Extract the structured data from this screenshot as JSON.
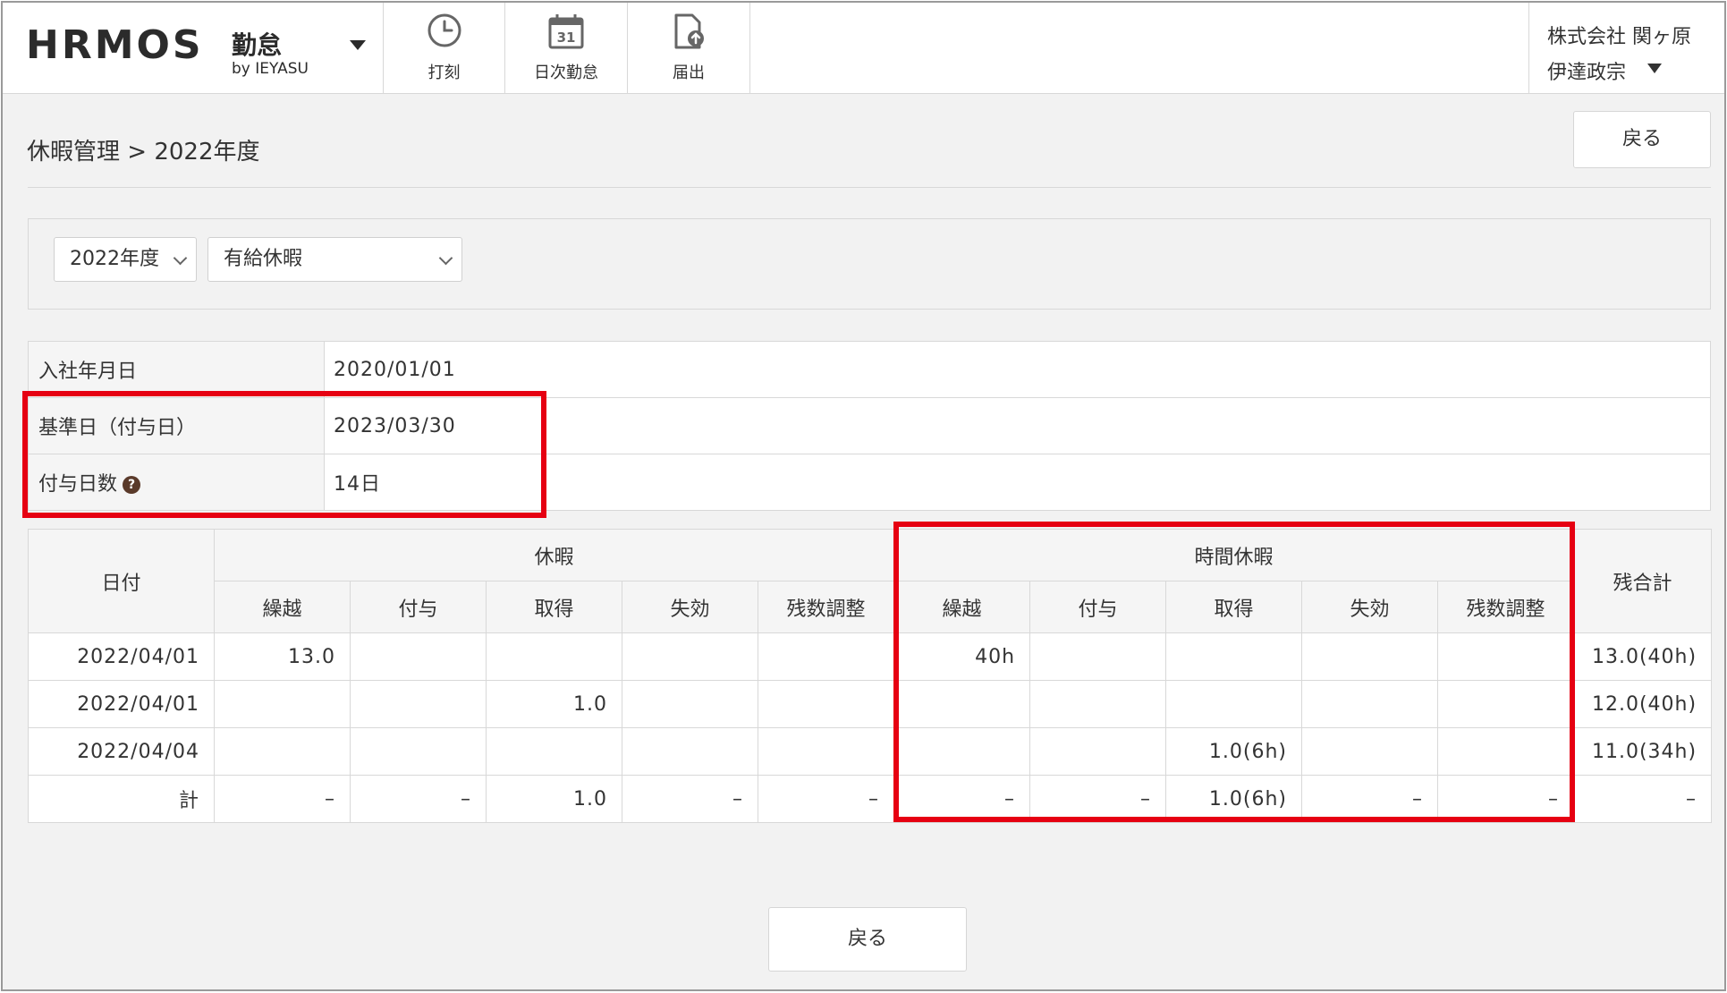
{
  "header": {
    "logo_text": "HRMOS",
    "logo_product": "勤怠",
    "logo_by": "by IEYASU",
    "nav": [
      {
        "label": "打刻",
        "icon": "clock-icon"
      },
      {
        "label": "日次勤怠",
        "icon": "calendar-icon"
      },
      {
        "label": "届出",
        "icon": "document-upload-icon"
      }
    ],
    "company": "株式会社 関ヶ原",
    "user": "伊達政宗"
  },
  "breadcrumb": "休暇管理 > 2022年度",
  "back_label": "戻る",
  "filter": {
    "year": "2022年度",
    "type": "有給休暇"
  },
  "info": [
    {
      "label": "入社年月日",
      "value": "2020/01/01"
    },
    {
      "label": "基準日（付与日）",
      "value": "2023/03/30"
    },
    {
      "label": "付与日数",
      "value": "14日"
    }
  ],
  "table": {
    "col_date": "日付",
    "group_leave": "休暇",
    "group_hourly": "時間休暇",
    "col_remaining": "残合計",
    "sub_cols": [
      "繰越",
      "付与",
      "取得",
      "失効",
      "残数調整"
    ],
    "rows": [
      {
        "date": "2022/04/01",
        "cells": [
          "13.0",
          "",
          "",
          "",
          "",
          "40h",
          "",
          "",
          "",
          ""
        ],
        "remaining": "13.0(40h)"
      },
      {
        "date": "2022/04/01",
        "cells": [
          "",
          "",
          "1.0",
          "",
          "",
          "",
          "",
          "",
          "",
          ""
        ],
        "remaining": "12.0(40h)"
      },
      {
        "date": "2022/04/04",
        "cells": [
          "",
          "",
          "",
          "",
          "",
          "",
          "",
          "1.0(6h)",
          "",
          ""
        ],
        "remaining": "11.0(34h)"
      },
      {
        "date": "計",
        "cells": [
          "–",
          "–",
          "1.0",
          "–",
          "–",
          "–",
          "–",
          "1.0(6h)",
          "–",
          "–"
        ],
        "remaining": "–"
      }
    ]
  },
  "colors": {
    "highlight": "#e60012",
    "background": "#f2f2f2",
    "border": "#d8d8d8"
  }
}
